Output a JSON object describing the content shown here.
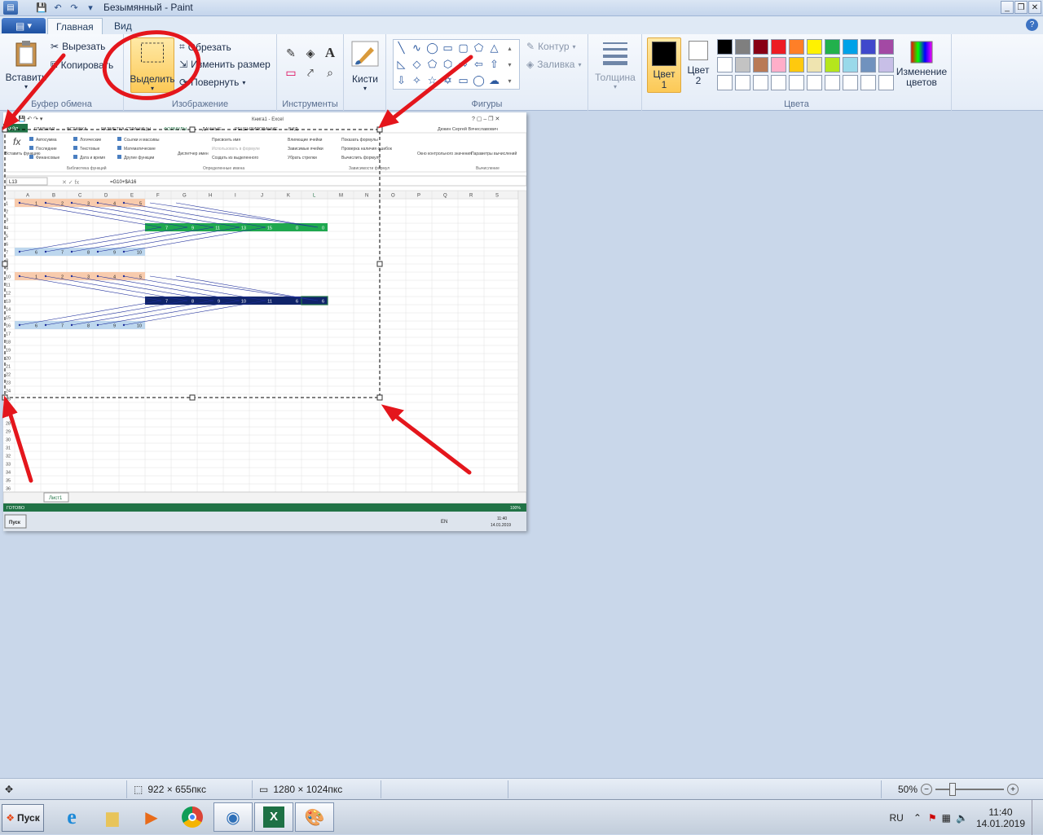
{
  "window": {
    "title": "Безымянный - Paint",
    "help": "?"
  },
  "tabs": {
    "file": "▾",
    "home": "Главная",
    "view": "Вид"
  },
  "clipboard": {
    "paste": "Вставить",
    "cut": "Вырезать",
    "copy": "Копировать",
    "label": "Буфер обмена"
  },
  "image": {
    "select": "Выделить",
    "crop": "Обрезать",
    "resize": "Изменить размер",
    "rotate": "Повернуть",
    "label": "Изображение"
  },
  "tools": {
    "label": "Инструменты",
    "text_tool": "A"
  },
  "brushes": {
    "label": "Кисти"
  },
  "shapes": {
    "outline": "Контур",
    "fill": "Заливка",
    "label": "Фигуры"
  },
  "size": {
    "label": "Толщина"
  },
  "colors": {
    "color1": "Цвет 1",
    "color2": "Цвет 2",
    "edit": "Изменение цветов",
    "label": "Цвета",
    "palette_row1": [
      "#000000",
      "#7f7f7f",
      "#880015",
      "#ed1c24",
      "#ff7f27",
      "#fff200",
      "#22b14c",
      "#00a2e8",
      "#3f48cc",
      "#a349a4"
    ],
    "palette_row2": [
      "#ffffff",
      "#c3c3c3",
      "#b97a57",
      "#ffaec9",
      "#ffc90e",
      "#efe4b0",
      "#b5e61d",
      "#99d9ea",
      "#7092be",
      "#c8bfe7"
    ]
  },
  "status": {
    "selection": "922 × 655пкс",
    "canvas_size": "1280 × 1024пкс",
    "zoom": "50%"
  },
  "taskbar": {
    "start": "Пуск",
    "lang": "RU",
    "time": "11:40",
    "date": "14.01.2019"
  },
  "excel": {
    "title": "Книга1 - Excel",
    "user": "Дюкин Сергей Вячеславович",
    "tabs": [
      "ФАЙЛ",
      "ГЛАВНАЯ",
      "ВСТАВКА",
      "РАЗМЕТКА СТРАНИЦЫ",
      "ФОРМУЛЫ",
      "ДАННЫЕ",
      "РЕЦЕНЗИРОВАНИЕ",
      "ВИД"
    ],
    "insert_func": "Вставить функцию",
    "lib_items": [
      "Автосумма",
      "Последние",
      "Финансовые",
      "Логические",
      "Текстовые",
      "Дата и время",
      "Ссылки и массивы",
      "Математические",
      "Другие функции"
    ],
    "lib_label": "Библиотека функций",
    "names_mgr": "Диспетчер имен",
    "names_items": [
      "Присвоить имя",
      "Использовать в формуле",
      "Создать из выделенного"
    ],
    "names_label": "Определенные имена",
    "audit_items": [
      "Влияющие ячейки",
      "Зависимые ячейки",
      "Убрать стрелки",
      "Показать формулы",
      "Проверка наличия ошибок",
      "Вычислить формулу"
    ],
    "watch": "Окно контрольного значения",
    "audit_label": "Зависимости формул",
    "calc_opts": "Параметры вычислений",
    "calc_label": "Вычисление",
    "namebox": "L13",
    "formula": "=G10+$A16",
    "columns": [
      "A",
      "B",
      "C",
      "D",
      "E",
      "F",
      "G",
      "H",
      "I",
      "J",
      "K",
      "L",
      "M",
      "N",
      "O",
      "P",
      "Q",
      "R",
      "S"
    ],
    "row1_vals": [
      "1",
      "2",
      "3",
      "4",
      "5"
    ],
    "row4_vals": [
      "7",
      "9",
      "11",
      "13",
      "15",
      "0",
      "0"
    ],
    "row7_vals": [
      "6",
      "7",
      "8",
      "9",
      "10"
    ],
    "row10_vals": [
      "1",
      "2",
      "3",
      "4",
      "5"
    ],
    "row13_vals": [
      "7",
      "8",
      "9",
      "10",
      "11",
      "6",
      "6"
    ],
    "row16_vals": [
      "6",
      "7",
      "8",
      "9",
      "10"
    ],
    "sheet": "Лист1",
    "ready": "ГОТОВО",
    "zoom": "100%",
    "tb_start": "Пуск",
    "tb_lang": "EN",
    "tb_time": "11:40",
    "tb_date": "14.01.2019"
  }
}
